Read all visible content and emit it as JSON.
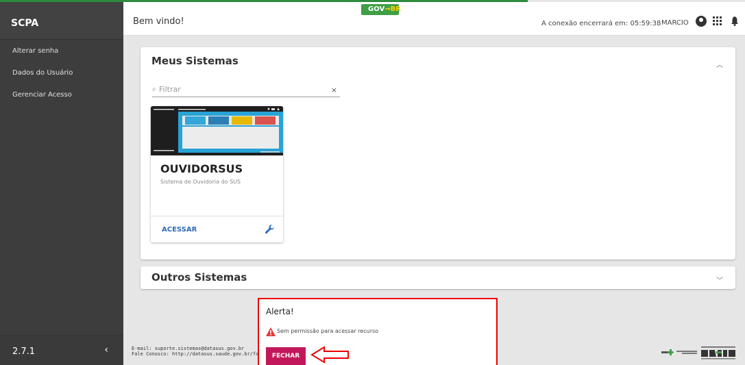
{
  "sidebar": {
    "title": "SCPA",
    "items": [
      {
        "label": "Alterar senha"
      },
      {
        "label": "Dados do Usuário"
      },
      {
        "label": "Gerenciar Acesso"
      }
    ],
    "version": "2.7.1",
    "collapse_glyph": "‹"
  },
  "header": {
    "welcome": "Bem vindo!",
    "gov_badge": {
      "left": "GOV",
      "arrow": "→",
      "right": "BR"
    },
    "connection_text": "A conexão encerrará em: 05:59:38",
    "user_name": "MARCIO"
  },
  "meus_sistemas": {
    "title": "Meus Sistemas",
    "filter_placeholder": "Filtrar",
    "cards": [
      {
        "title": "OUVIDORSUS",
        "subtitle": "Sistema de Ouvidoria do SUS",
        "action_label": "ACESSAR"
      }
    ]
  },
  "outros_sistemas": {
    "title": "Outros Sistemas"
  },
  "footer": {
    "email": "E-mail: suporte.sistemas@datasus.gov.br",
    "contact": "Fale Conosco: http://datasus.saude.gov.br/fale-conosco"
  },
  "alert": {
    "title": "Alerta!",
    "message": "Sem permissão para acessar recurso",
    "close_label": "FECHAR"
  },
  "colors": {
    "accent_green": "#3f9e46",
    "sidebar_bg": "#3d3d3d",
    "action_blue": "#2f6bb5",
    "alert_button": "#c2185b",
    "alert_border": "#ee0000"
  }
}
